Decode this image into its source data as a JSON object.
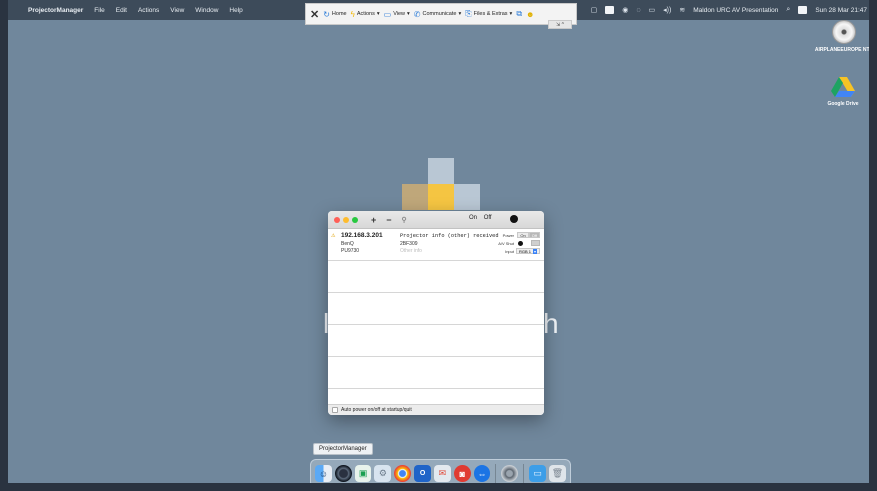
{
  "menubar": {
    "app_name": "ProjectorManager",
    "menus": [
      "File",
      "Edit",
      "Actions",
      "View",
      "Window",
      "Help"
    ],
    "session_title": "Maldon URC AV Presentation",
    "clock": "Sun 28 Mar  21:47"
  },
  "toolbar": {
    "close": "✕",
    "home": "Home",
    "actions": "Actions",
    "view": "View",
    "communicate": "Communicate",
    "files": "Files & Extras",
    "sub": "⇲ ^"
  },
  "desktop": {
    "icon1": "AIRPLANEEUROPE NTH",
    "icon2": "Google Drive"
  },
  "window": {
    "on_label": "On",
    "off_label": "Off",
    "add": "+",
    "remove": "−",
    "link": "⚲",
    "projector": {
      "ip": "192.168.3.201",
      "brand": "BenQ",
      "model": "PU9730",
      "status": "Projector info (other) received",
      "serial": "2BF309",
      "other_info_placeholder": "Other info",
      "power_label": "Power",
      "power_on": "On",
      "power_off": "Off",
      "shut_label": "A/V Shut",
      "input_label": "Input",
      "input_value": "RGB 1"
    },
    "footer_label": "Auto power on/off at startup/quit"
  },
  "background_text": {
    "left": "l",
    "right": "h"
  },
  "dock": {
    "tooltip": "ProjectorManager"
  },
  "colors": {
    "desktop": "#70879c",
    "menubar": "#3d4b5a",
    "tile_yellow": "#f5c542",
    "tile_tan": "#bfa77a",
    "tile_light": "#b9c7d4"
  }
}
